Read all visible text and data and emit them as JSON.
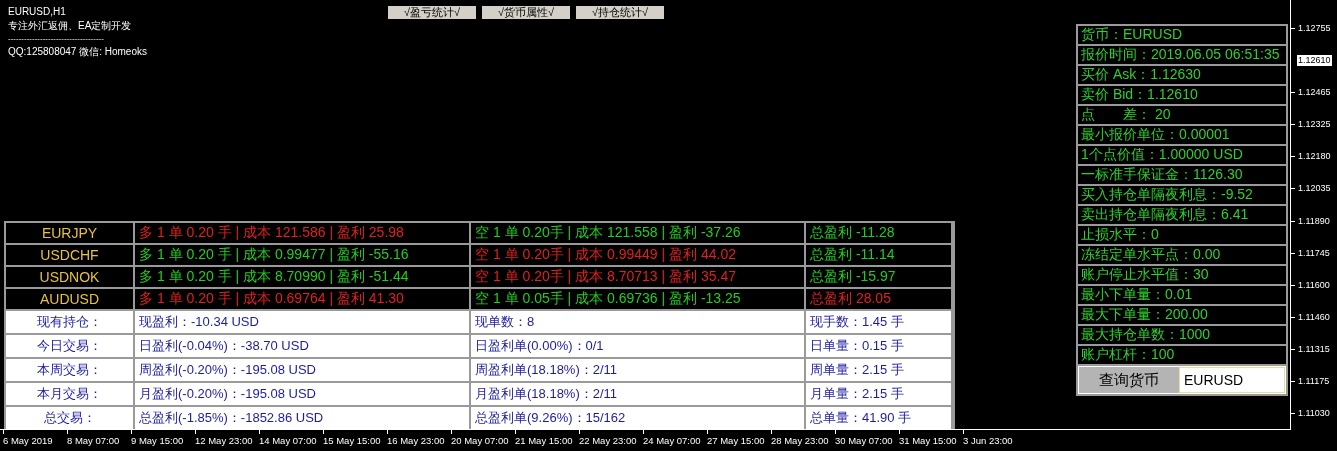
{
  "chart": {
    "symbol_timeframe": "EURUSD,H1",
    "tagline": "专注外汇返佣、EA定制开发",
    "divider": "------------------------------------",
    "contact": "QQ:125808047 微信: Homeoks"
  },
  "toggle_buttons": [
    "√盈亏统计√",
    "√货币属性√",
    "√持仓统计√"
  ],
  "positions": [
    {
      "symbol": "EURJPY",
      "long": {
        "text": "多 1 单 0.20 手 | 成本 121.586 | 盈利 25.98",
        "in_profit": true
      },
      "short": {
        "text": "空 1 单 0.20手 | 成本 121.558 | 盈利 -37.26",
        "in_profit": false
      },
      "total": {
        "text": "总盈利 -11.28",
        "in_profit": false
      }
    },
    {
      "symbol": "USDCHF",
      "long": {
        "text": "多 1 单 0.20 手 | 成本 0.99477 | 盈利 -55.16",
        "in_profit": false
      },
      "short": {
        "text": "空 1 单 0.20手 | 成本 0.99449 | 盈利 44.02",
        "in_profit": true
      },
      "total": {
        "text": "总盈利 -11.14",
        "in_profit": false
      }
    },
    {
      "symbol": "USDNOK",
      "long": {
        "text": "多 1 单 0.20 手 | 成本 8.70990 | 盈利 -51.44",
        "in_profit": false
      },
      "short": {
        "text": "空 1 单 0.20手 | 成本 8.70713 | 盈利 35.47",
        "in_profit": true
      },
      "total": {
        "text": "总盈利 -15.97",
        "in_profit": false
      }
    },
    {
      "symbol": "AUDUSD",
      "long": {
        "text": "多 1 单 0.20 手 | 成本 0.69764 | 盈利 41.30",
        "in_profit": true
      },
      "short": {
        "text": "空 1 单 0.05手 | 成本 0.69736 | 盈利 -13.25",
        "in_profit": false
      },
      "total": {
        "text": "总盈利 28.05",
        "in_profit": true
      }
    }
  ],
  "stats": [
    {
      "label": "现有持仓：",
      "profit": "现盈利：-10.34 USD",
      "orders": "现单数：8",
      "lots": "现手数：1.45 手"
    },
    {
      "label": "今日交易：",
      "profit": "日盈利(-0.04%)：-38.70 USD",
      "orders": "日盈利单(0.00%)：0/1",
      "lots": "日单量：0.15 手"
    },
    {
      "label": "本周交易：",
      "profit": "周盈利(-0.20%)：-195.08 USD",
      "orders": "周盈利单(18.18%)：2/11",
      "lots": "周单量：2.15 手"
    },
    {
      "label": "本月交易：",
      "profit": "月盈利(-0.20%)：-195.08 USD",
      "orders": "月盈利单(18.18%)：2/11",
      "lots": "月单量：2.15 手"
    },
    {
      "label": "总交易：",
      "profit": "总盈利(-1.85%)：-1852.86 USD",
      "orders": "总盈利单(9.26%)：15/162",
      "lots": "总单量：41.90 手"
    }
  ],
  "info_panel": {
    "rows": [
      "货币：EURUSD",
      "报价时间：2019.06.05 06:51:35",
      "买价 Ask：1.12630",
      "卖价 Bid：1.12610",
      "点　　差： 20",
      "最小报价单位：0.00001",
      "1个点价值：1.00000 USD",
      "一标准手保证金：1126.30",
      "买入持仓单隔夜利息：-9.52",
      "卖出持仓单隔夜利息：6.41",
      "止损水平：0",
      "冻结定单水平点：0.00",
      "账户停止水平值：30",
      "最小下单量：0.01",
      "最大下单量：200.00",
      "最大持仓单数：1000",
      "账户杠杆：100"
    ],
    "query_button": "查询货币",
    "query_field": {
      "value": "EURUSD"
    }
  },
  "price_axis": [
    {
      "label": "1.12755",
      "current": false
    },
    {
      "label": "1.12610",
      "current": true
    },
    {
      "label": "1.12465",
      "current": false
    },
    {
      "label": "1.12325",
      "current": false
    },
    {
      "label": "1.12180",
      "current": false
    },
    {
      "label": "1.12035",
      "current": false
    },
    {
      "label": "1.11890",
      "current": false
    },
    {
      "label": "1.11745",
      "current": false
    },
    {
      "label": "1.11600",
      "current": false
    },
    {
      "label": "1.11460",
      "current": false
    },
    {
      "label": "1.11315",
      "current": false
    },
    {
      "label": "1.11175",
      "current": false
    },
    {
      "label": "1.11030",
      "current": false
    }
  ],
  "time_axis": [
    "6 May 2019",
    "8 May 07:00",
    "9 May 15:00",
    "12 May 23:00",
    "14 May 07:00",
    "15 May 15:00",
    "16 May 23:00",
    "20 May 07:00",
    "21 May 15:00",
    "22 May 23:00",
    "24 May 07:00",
    "27 May 15:00",
    "28 May 23:00",
    "30 May 07:00",
    "31 May 15:00",
    "3 Jun 23:00"
  ]
}
